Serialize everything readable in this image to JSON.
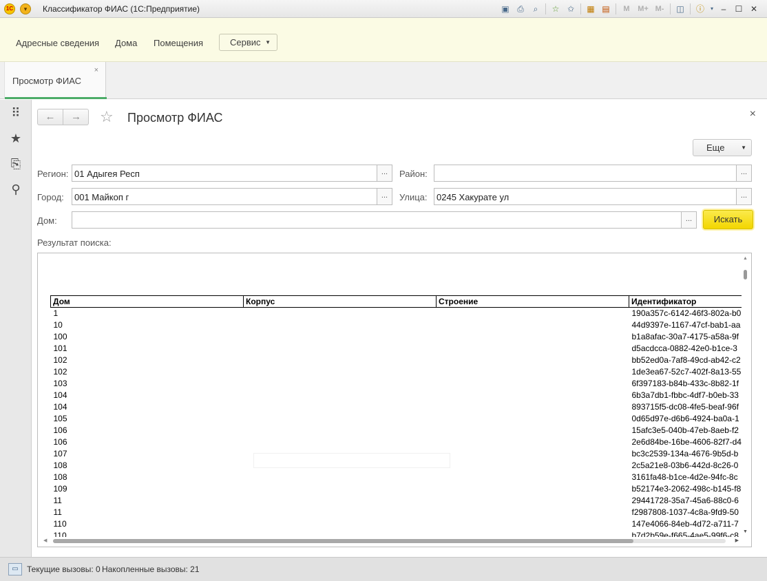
{
  "window": {
    "title": "Классификатор ФИАС  (1С:Предприятие)",
    "logo_icon": "1c-logo-icon",
    "toolbar_icons": [
      "save-icon",
      "print-icon",
      "preview-icon",
      "favorite-add-icon",
      "favorites-icon",
      "calculator-icon",
      "calendar-icon"
    ],
    "memory_buttons": [
      "M",
      "M+",
      "M-"
    ]
  },
  "sections": {
    "items": [
      "Адресные сведения",
      "Дома",
      "Помещения"
    ],
    "service_label": "Сервис"
  },
  "tabs": [
    {
      "label": "Просмотр ФИАС",
      "active": true
    }
  ],
  "form": {
    "title": "Просмотр ФИАС",
    "more_label": "Еще",
    "fields": {
      "region": {
        "label": "Регион:",
        "value": "01 Адыгея Респ"
      },
      "district": {
        "label": "Район:",
        "value": ""
      },
      "city": {
        "label": "Город:",
        "value": "001 Майкоп г"
      },
      "street": {
        "label": "Улица:",
        "value": "0245 Хакурате ул"
      },
      "house": {
        "label": "Дом:",
        "value": ""
      }
    },
    "dots": "...",
    "search_label": "Искать",
    "result_label": "Результат поиска:"
  },
  "table": {
    "columns": [
      "Дом",
      "Корпус",
      "Строение",
      "Идентификатор"
    ],
    "rows": [
      [
        "1",
        "",
        "",
        "190a357c-6142-46f3-802a-b0"
      ],
      [
        "10",
        "",
        "",
        "44d9397e-1167-47cf-bab1-aa"
      ],
      [
        "100",
        "",
        "",
        "b1a8afac-30a7-4175-a58a-9f"
      ],
      [
        "101",
        "",
        "",
        "d5acdcca-0882-42e0-b1ce-3"
      ],
      [
        "102",
        "",
        "",
        "bb52ed0a-7af8-49cd-ab42-c2"
      ],
      [
        "102",
        "",
        "",
        "1de3ea67-52c7-402f-8a13-55"
      ],
      [
        "103",
        "",
        "",
        "6f397183-b84b-433c-8b82-1f"
      ],
      [
        "104",
        "",
        "",
        "6b3a7db1-fbbc-4df7-b0eb-33"
      ],
      [
        "104",
        "",
        "",
        "893715f5-dc08-4fe5-beaf-96f"
      ],
      [
        "105",
        "",
        "",
        "0d65d97e-d6b6-4924-ba0a-1"
      ],
      [
        "106",
        "",
        "",
        "15afc3e5-040b-47eb-8aeb-f2"
      ],
      [
        "106",
        "",
        "",
        "2e6d84be-16be-4606-82f7-d4"
      ],
      [
        "107",
        "",
        "",
        "bc3c2539-134a-4676-9b5d-b"
      ],
      [
        "108",
        "",
        "",
        "2c5a21e8-03b6-442d-8c26-0"
      ],
      [
        "108",
        "",
        "",
        "3161fa48-b1ce-4d2e-94fc-8c"
      ],
      [
        "109",
        "",
        "",
        "b52174e3-2062-498c-b145-f8"
      ],
      [
        "11",
        "",
        "",
        "29441728-35a7-45a6-88c0-6"
      ],
      [
        "11",
        "",
        "",
        "f2987808-1037-4c8a-9fd9-50"
      ],
      [
        "110",
        "",
        "",
        "147e4066-84eb-4d72-a711-7"
      ],
      [
        "110",
        "",
        "",
        "b7d2b59e-f665-4ae5-99f6-c8"
      ]
    ]
  },
  "statusbar": {
    "current_calls": "Текущие вызовы: 0",
    "accumulated_calls": "Накопленные вызовы: 21"
  }
}
